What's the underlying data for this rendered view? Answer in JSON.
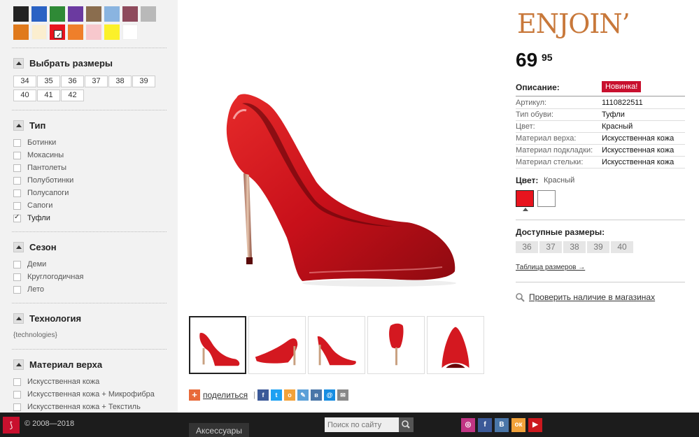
{
  "filters": {
    "colors": [
      {
        "color": "#222222"
      },
      {
        "color": "#2a62c4"
      },
      {
        "color": "#2f8a36"
      },
      {
        "color": "#6b3aa0"
      },
      {
        "color": "#8a6d4e"
      },
      {
        "color": "#8ab4e0"
      },
      {
        "color": "#8e4a5c"
      },
      {
        "color": "#b9b9b9"
      },
      {
        "color": "#e07a1c"
      },
      {
        "color": "#fbeecf"
      },
      {
        "color": "#e8141e",
        "checked": true
      },
      {
        "color": "#ef7f2a"
      },
      {
        "color": "#f7c8cd"
      },
      {
        "color": "#fbf12a"
      },
      {
        "color": "#ffffff"
      }
    ],
    "sizes_title": "Выбрать размеры",
    "sizes": [
      "34",
      "35",
      "36",
      "37",
      "38",
      "39",
      "40",
      "41",
      "42"
    ],
    "type_title": "Тип",
    "types": [
      {
        "label": "Ботинки",
        "checked": false
      },
      {
        "label": "Мокасины",
        "checked": false
      },
      {
        "label": "Пантолеты",
        "checked": false
      },
      {
        "label": "Полуботинки",
        "checked": false
      },
      {
        "label": "Полусапоги",
        "checked": false
      },
      {
        "label": "Сапоги",
        "checked": false
      },
      {
        "label": "Туфли",
        "checked": true
      }
    ],
    "season_title": "Сезон",
    "seasons": [
      {
        "label": "Деми",
        "checked": false
      },
      {
        "label": "Круглогодичная",
        "checked": false
      },
      {
        "label": "Лето",
        "checked": false
      }
    ],
    "tech_title": "Технология",
    "tech_text": "{technologies}",
    "material_title": "Материал верха",
    "materials": [
      {
        "label": "Искусственная кожа",
        "checked": false
      },
      {
        "label": "Искусственная кожа + Микрофибра",
        "checked": false
      },
      {
        "label": "Искусственная кожа + Текстиль",
        "checked": false
      }
    ]
  },
  "product": {
    "brand": "ENJOIN’",
    "price_main": "69",
    "price_cents": "95",
    "description_label": "Описание:",
    "new_badge": "Новинка!",
    "attributes": [
      {
        "k": "Артикул:",
        "v": "1110822511"
      },
      {
        "k": "Тип обуви:",
        "v": "Туфли"
      },
      {
        "k": "Цвет:",
        "v": "Красный"
      },
      {
        "k": "Материал верха:",
        "v": "Искусственная кожа"
      },
      {
        "k": "Материал подкладки:",
        "v": "Искусственная кожа"
      },
      {
        "k": "Материал стельки:",
        "v": "Искусственная кожа"
      }
    ],
    "color_label": "Цвет:",
    "color_value": "Красный",
    "color_options": [
      "#e8141e",
      "#ffffff"
    ],
    "available_label": "Доступные размеры:",
    "available_sizes": [
      "36",
      "37",
      "38",
      "39",
      "40"
    ],
    "size_table_link": "Таблица размеров →",
    "check_store": "Проверить наличие в магазинах"
  },
  "share": {
    "label": "поделиться",
    "icons": [
      {
        "name": "facebook-icon",
        "glyph": "f",
        "color": "#3b5998"
      },
      {
        "name": "twitter-icon",
        "glyph": "t",
        "color": "#1da1f2"
      },
      {
        "name": "odnoklassniki-icon",
        "glyph": "o",
        "color": "#f2a23a"
      },
      {
        "name": "livejournal-icon",
        "glyph": "✎",
        "color": "#5aa0d8"
      },
      {
        "name": "vkontakte-icon",
        "glyph": "в",
        "color": "#4a76a8"
      },
      {
        "name": "mailru-icon",
        "glyph": "@",
        "color": "#168de2"
      },
      {
        "name": "email-icon",
        "glyph": "✉",
        "color": "#888888"
      }
    ]
  },
  "footer": {
    "logo": "⟆",
    "copyright": "© 2008—2018",
    "search_placeholder": "Поиск по сайту",
    "accessories": "Аксессуары",
    "social": [
      {
        "name": "instagram-icon",
        "glyph": "◎",
        "color": "#c13584"
      },
      {
        "name": "facebook-icon",
        "glyph": "f",
        "color": "#3b5998"
      },
      {
        "name": "vkontakte-icon",
        "glyph": "В",
        "color": "#4a76a8"
      },
      {
        "name": "odnoklassniki-icon",
        "glyph": "ок",
        "color": "#f2a23a"
      },
      {
        "name": "youtube-icon",
        "glyph": "▶",
        "color": "#cc181e"
      }
    ]
  }
}
